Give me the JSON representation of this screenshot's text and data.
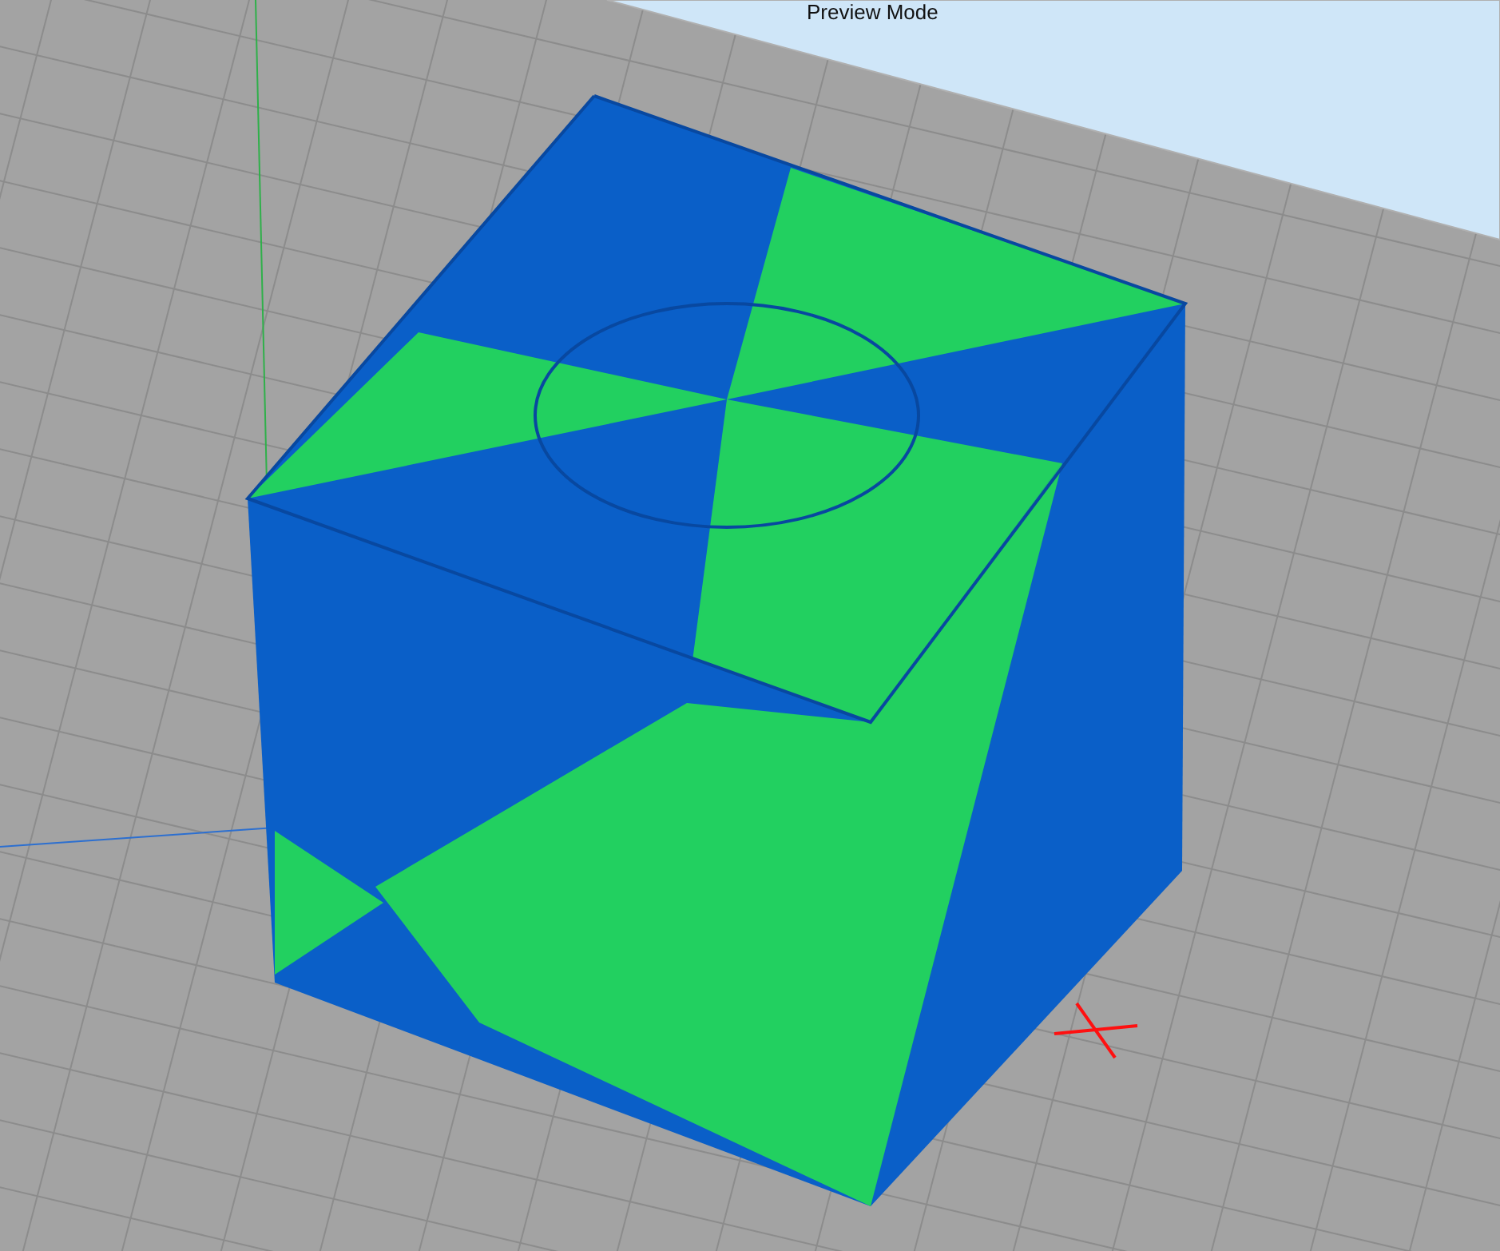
{
  "viewport": {
    "mode_label": "Preview Mode"
  }
}
